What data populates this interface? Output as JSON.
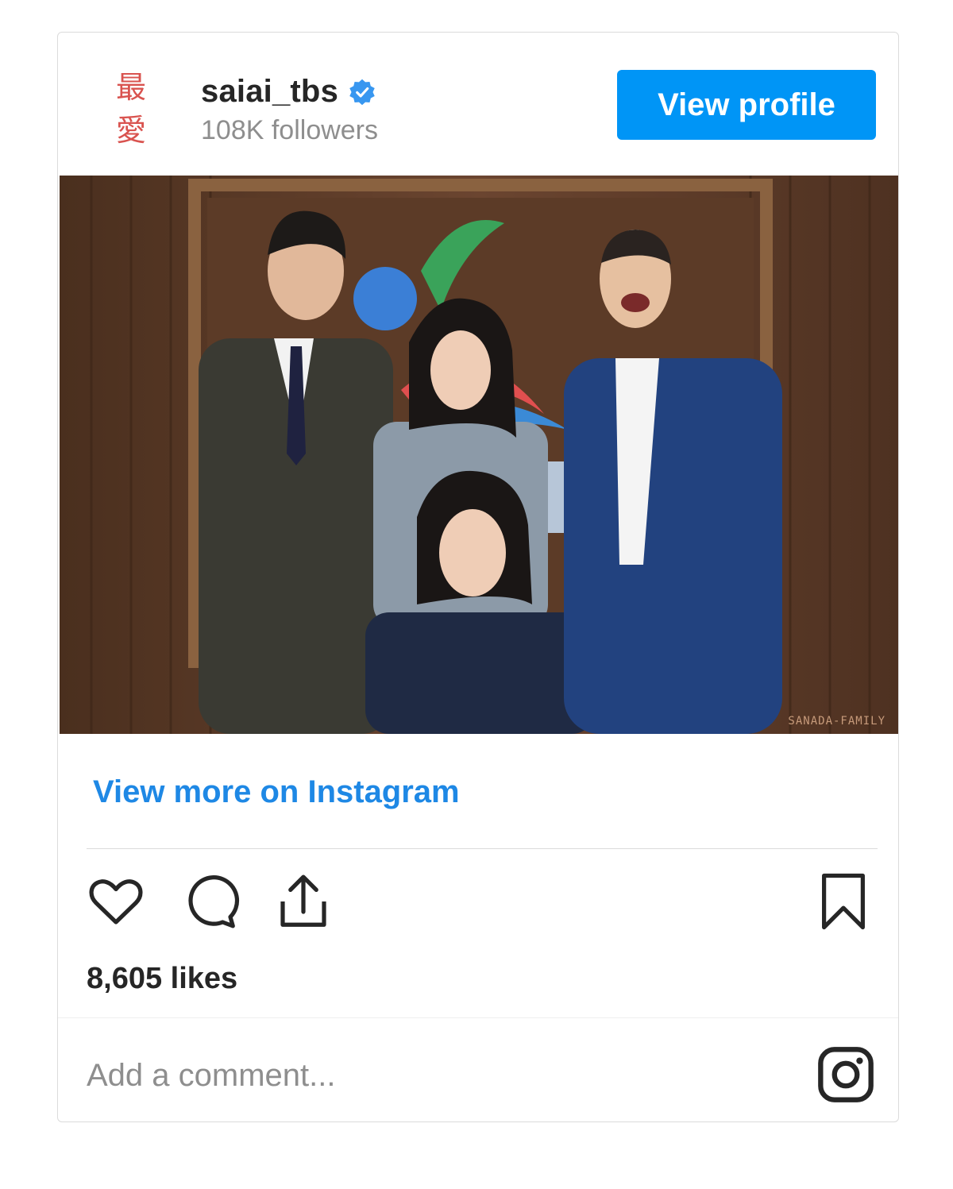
{
  "header": {
    "avatar_chars": [
      "最",
      "愛"
    ],
    "username": "saiai_tbs",
    "followers": "108K followers",
    "view_profile_label": "View profile"
  },
  "photo": {
    "watermark": "SANADA-FAMILY"
  },
  "view_more_label": "View more on Instagram",
  "actions": {
    "icons": [
      "heart-icon",
      "comment-icon",
      "share-icon",
      "bookmark-icon"
    ]
  },
  "likes": "8,605 likes",
  "comment": {
    "placeholder": "Add a comment...",
    "value": ""
  },
  "colors": {
    "accent": "#0095f6",
    "link": "#1e88e5",
    "verified": "#3897f0",
    "text": "#262626",
    "muted": "#8e8e8e"
  }
}
